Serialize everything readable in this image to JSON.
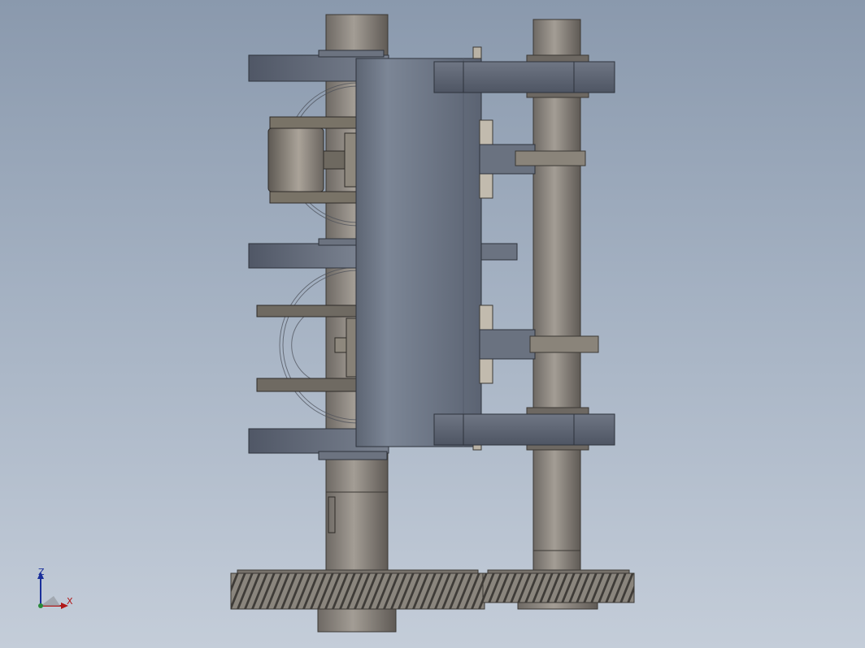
{
  "viewport": {
    "background_top": "#8a99ad",
    "background_bottom": "#c4cdd9"
  },
  "model": {
    "part_colors": {
      "shaft": "#8f8983",
      "arm": "#656d7b",
      "block": "#76808f",
      "pin": "#b9b2a5",
      "gear": "#7e7a73"
    }
  },
  "triad": {
    "z_label": "Z",
    "x_label": "X",
    "z_color": "#1a2f9a",
    "x_color": "#b01818"
  }
}
